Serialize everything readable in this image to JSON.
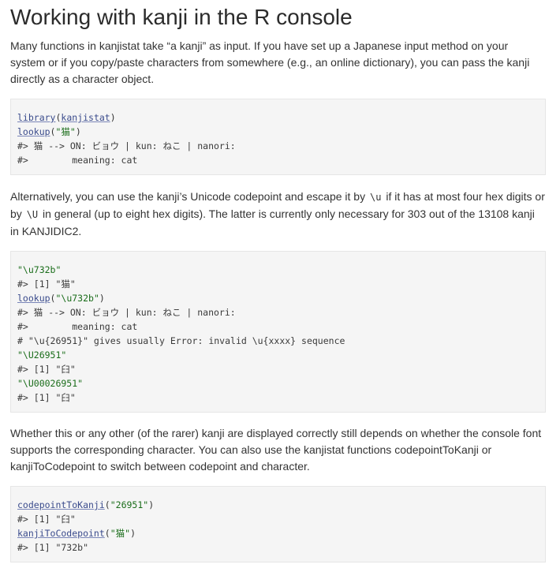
{
  "heading": "Working with kanji in the R console",
  "paragraphs": {
    "p1": "Many functions in kanjistat take “a kanji” as input. If you have set up a Japanese input method on your system or if you copy/paste characters from somewhere (e.g., an online dictionary), you can pass the kanji directly as a character object.",
    "p2": {
      "part1": "Alternatively, you can use the kanji’s Unicode codepoint and escape it by ",
      "code1": "\\u",
      "part2": " if it has at most four hex digits or by ",
      "code2": "\\U",
      "part3": " in general (up to eight hex digits). The latter is currently only necessary for 303 out of the 13108 kanji in KANJIDIC2."
    },
    "p3": "Whether this or any other (of the rarer) kanji are displayed correctly still depends on whether the console font supports the corresponding character. You can also use the kanjistat functions codepointToKanji or kanjiToCodepoint to switch between codepoint and character."
  },
  "code_block_1": {
    "l1": {
      "fn": "library",
      "open": "(",
      "arg": "kanjistat",
      "close": ")"
    },
    "l2": {
      "fn": "lookup",
      "open": "(",
      "arg": "\"猫\"",
      "close": ")"
    },
    "l3": "#> 猫 --> ON: ビョウ | kun: ねこ | nanori:",
    "l4": "#>        meaning: cat"
  },
  "code_block_2": {
    "l1": "\"\\u732b\"",
    "l2": "#> [1] \"猫\"",
    "l3": {
      "fn": "lookup",
      "open": "(",
      "arg": "\"\\u732b\"",
      "close": ")"
    },
    "l4": "#> 猫 --> ON: ビョウ | kun: ねこ | nanori:",
    "l5": "#>        meaning: cat",
    "l6": "# \"\\u{26951}\" gives usually Error: invalid \\u{xxxx} sequence",
    "l7": "\"\\U26951\"",
    "l8": "#> [1] \"𦥑\"",
    "l9": "\"\\U00026951\"",
    "l10": "#> [1] \"𦥑\""
  },
  "code_block_3": {
    "l1": {
      "fn": "codepointToKanji",
      "open": "(",
      "arg": "\"26951\"",
      "close": ")"
    },
    "l2": "#> [1] \"𦥑\"",
    "l3": {
      "fn": "kanjiToCodepoint",
      "open": "(",
      "arg": "\"猫\"",
      "close": ")"
    },
    "l4": "#> [1] \"732b\""
  }
}
